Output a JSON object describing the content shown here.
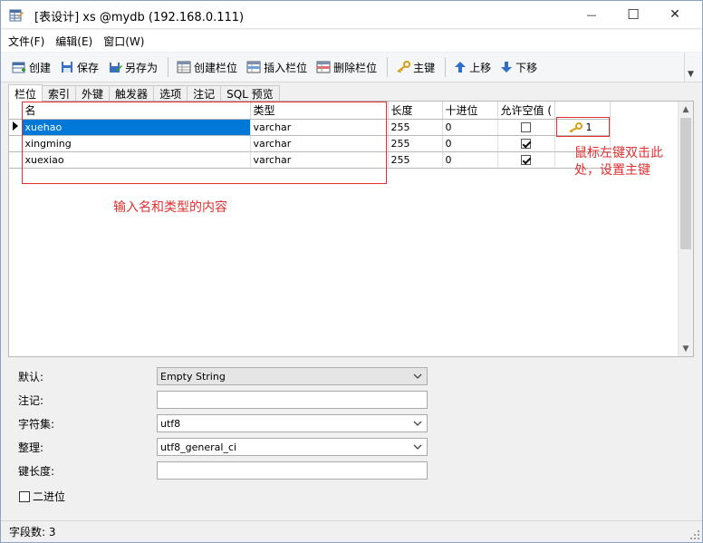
{
  "window": {
    "title": "[表设计] xs @mydb (192.168.0.111)",
    "minimize_glyph": "—",
    "maximize_glyph": "☐",
    "close_glyph": "✕"
  },
  "menu": [
    "文件(F)",
    "编辑(E)",
    "窗口(W)"
  ],
  "toolbar": {
    "create": "创建",
    "save": "保存",
    "save_as": "另存为",
    "create_field": "创建栏位",
    "insert_field": "插入栏位",
    "delete_field": "删除栏位",
    "primary_key": "主键",
    "move_up": "上移",
    "move_down": "下移"
  },
  "tabs": [
    "栏位",
    "索引",
    "外键",
    "触发器",
    "选项",
    "注记",
    "SQL 预览"
  ],
  "grid": {
    "columns": [
      "名",
      "类型",
      "长度",
      "十进位",
      "允许空值 ("
    ],
    "rows": [
      {
        "name": "xuehao",
        "type": "varchar",
        "length": "255",
        "decimals": "0",
        "nullable": false,
        "key": "1"
      },
      {
        "name": "xingming",
        "type": "varchar",
        "length": "255",
        "decimals": "0",
        "nullable": true,
        "key": ""
      },
      {
        "name": "xuexiao",
        "type": "varchar",
        "length": "255",
        "decimals": "0",
        "nullable": true,
        "key": ""
      }
    ]
  },
  "annotations": {
    "input_hint": "输入名和类型的内容",
    "key_hint_line1": "鼠标左键双击此",
    "key_hint_line2": "处，设置主键",
    "color": "#e03030"
  },
  "properties": {
    "default_label": "默认:",
    "default_value": "Empty String",
    "comment_label": "注记:",
    "comment_value": "",
    "charset_label": "字符集:",
    "charset_value": "utf8",
    "collation_label": "整理:",
    "collation_value": "utf8_general_ci",
    "key_length_label": "键长度:",
    "key_length_value": "",
    "binary_label": "二进位"
  },
  "status": {
    "field_count": "字段数: 3"
  },
  "colors": {
    "selection": "#0078d7",
    "key_icon": "#d4a017"
  }
}
